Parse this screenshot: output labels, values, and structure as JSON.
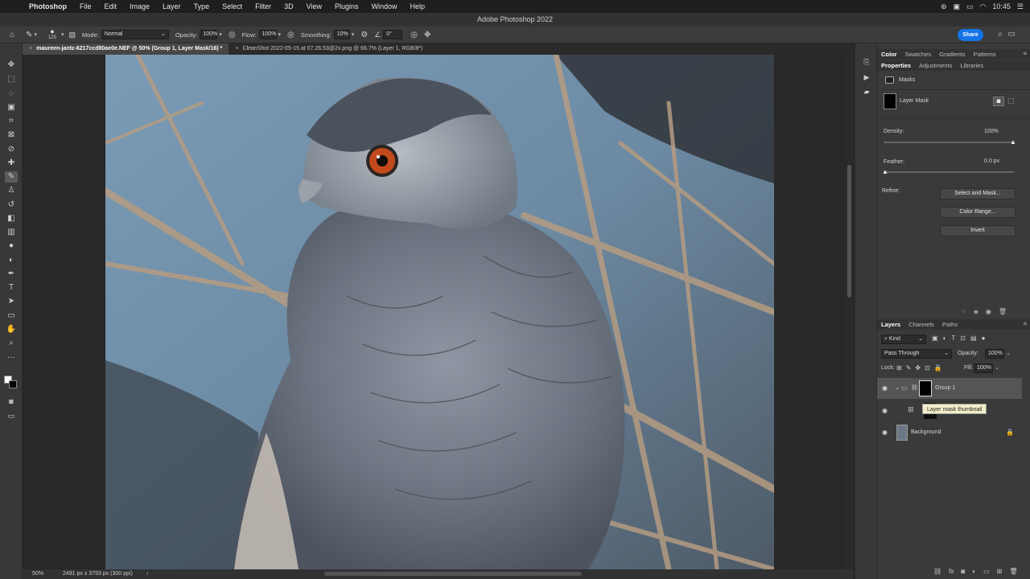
{
  "menubar": {
    "app": "Photoshop",
    "items": [
      "File",
      "Edit",
      "Image",
      "Layer",
      "Type",
      "Select",
      "Filter",
      "3D",
      "View",
      "Plugins",
      "Window",
      "Help"
    ],
    "time": "10:45"
  },
  "window": {
    "title": "Adobe Photoshop 2022"
  },
  "options": {
    "brush_size": "125",
    "mode_label": "Mode:",
    "mode_value": "Normal",
    "opacity_label": "Opacity:",
    "opacity_value": "100%",
    "flow_label": "Flow:",
    "flow_value": "100%",
    "smoothing_label": "Smoothing:",
    "smoothing_value": "10%",
    "angle_value": "0°",
    "share_label": "Share"
  },
  "tabs": [
    {
      "label": "maureen-jantz-6217ccd80ae0e.NEF @ 50% (Group 1, Layer Mask/16) *",
      "active": true
    },
    {
      "label": "CleanShot 2022-05-15 at 07.26.53@2x.png @ 66.7% (Layer 1, RGB/8*)",
      "active": false
    }
  ],
  "status": {
    "zoom": "50%",
    "doc_info": "2491 px x 3793 px (300 ppi)"
  },
  "panels": {
    "top_tabs": [
      "Color",
      "Swatches",
      "Gradients",
      "Patterns"
    ],
    "second_tabs": [
      "Properties",
      "Adjustments",
      "Libraries"
    ],
    "properties": {
      "masks_label": "Masks",
      "layer_mask_label": "Layer Mask",
      "density_label": "Density:",
      "density_value": "100%",
      "feather_label": "Feather:",
      "feather_value": "0.0 px",
      "refine_label": "Refine:",
      "select_mask_btn": "Select and Mask...",
      "color_range_btn": "Color Range...",
      "invert_btn": "Invert"
    },
    "layers_tabs": [
      "Layers",
      "Channels",
      "Paths"
    ],
    "layers": {
      "filter_kind": "Kind",
      "blend_mode": "Pass Through",
      "opacity_label": "Opacity:",
      "opacity_value": "100%",
      "lock_label": "Lock:",
      "fill_label": "Fill:",
      "fill_value": "100%",
      "items": [
        {
          "name": "Group 1"
        },
        {
          "name": "Background"
        }
      ],
      "tooltip": "Layer mask thumbnail"
    }
  }
}
